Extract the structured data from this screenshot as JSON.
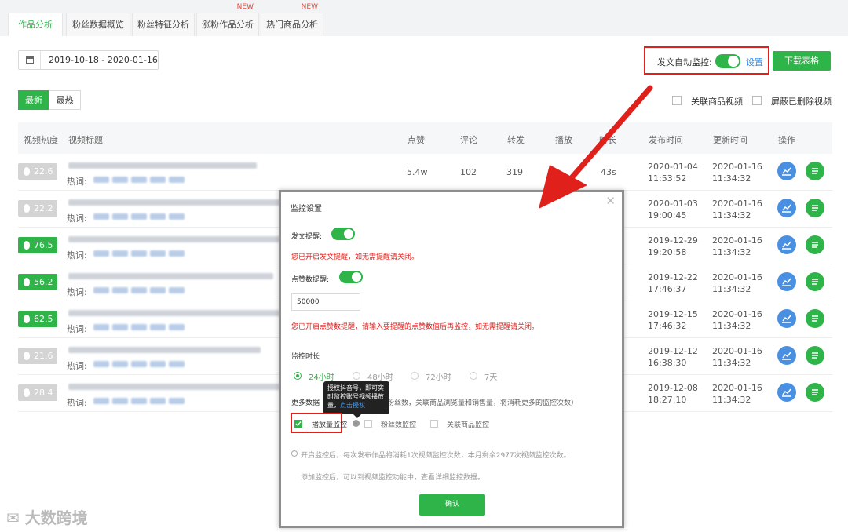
{
  "tabs": [
    {
      "label": "作品分析",
      "badge": ""
    },
    {
      "label": "粉丝数据概览",
      "badge": ""
    },
    {
      "label": "粉丝特征分析",
      "badge": ""
    },
    {
      "label": "涨粉作品分析",
      "badge": "NEW"
    },
    {
      "label": "热门商品分析",
      "badge": "NEW"
    }
  ],
  "date_range": "2019-10-18 - 2020-01-16",
  "auto_monitor": {
    "label": "发文自动监控:",
    "enabled": true,
    "settings_link": "设置"
  },
  "download_button": "下载表格",
  "sort": {
    "latest": "最新",
    "hottest": "最热"
  },
  "filters": {
    "linked_products": "关联商品视频",
    "hide_deleted": "屏蔽已删除视频"
  },
  "table": {
    "headers": [
      "视频热度",
      "视频标题",
      "点赞",
      "评论",
      "转发",
      "播放",
      "时长",
      "发布时间",
      "更新时间",
      "操作"
    ],
    "hot_label": "热词:",
    "rows": [
      {
        "heat": "22.6",
        "level": "low",
        "likes": "5.4w",
        "comments": "102",
        "shares": "319",
        "duration": "43s",
        "pub_date": "2020-01-04",
        "pub_time": "11:53:52",
        "upd_date": "2020-01-16",
        "upd_time": "11:34:32"
      },
      {
        "heat": "22.2",
        "level": "low",
        "pub_date": "2020-01-03",
        "pub_time": "19:00:45",
        "upd_date": "2020-01-16",
        "upd_time": "11:34:32"
      },
      {
        "heat": "76.5",
        "level": "high",
        "pub_date": "2019-12-29",
        "pub_time": "19:20:58",
        "upd_date": "2020-01-16",
        "upd_time": "11:34:32"
      },
      {
        "heat": "56.2",
        "level": "high",
        "pub_date": "2019-12-22",
        "pub_time": "17:46:37",
        "upd_date": "2020-01-16",
        "upd_time": "11:34:32"
      },
      {
        "heat": "62.5",
        "level": "high",
        "pub_date": "2019-12-15",
        "pub_time": "17:46:32",
        "upd_date": "2020-01-16",
        "upd_time": "11:34:32"
      },
      {
        "heat": "21.6",
        "level": "low",
        "pub_date": "2019-12-12",
        "pub_time": "16:38:30",
        "upd_date": "2020-01-16",
        "upd_time": "11:34:32"
      },
      {
        "heat": "28.4",
        "level": "low",
        "pub_date": "2019-12-08",
        "pub_time": "18:27:10",
        "upd_date": "2020-01-16",
        "upd_time": "11:34:32"
      }
    ]
  },
  "modal": {
    "title": "监控设置",
    "post_alert_label": "发文提醒:",
    "post_alert_note": "您已开启发文提醒，如无需提醒请关闭。",
    "like_alert_label": "点赞数提醒:",
    "like_threshold": "50000",
    "like_alert_note": "您已开启点赞数提醒，请输入要提醒的点赞数值后再监控，如无需提醒请关闭。",
    "duration_label": "监控时长",
    "durations": [
      "24小时",
      "48小时",
      "72小时",
      "7天"
    ],
    "more_data_prefix": "更多数据",
    "more_data_suffix": "粉丝数，关联商品浏览量和销售量，将消耗更多的监控次数）",
    "options": [
      "播放量监控",
      "粉丝数监控",
      "关联商品监控"
    ],
    "tooltip_line1": "授权抖音号，即可实",
    "tooltip_line2": "时监控账号视频播放",
    "tooltip_line3_prefix": "量，",
    "tooltip_link": "点击授权",
    "info1": "开启监控后，每次发布作品将消耗1次视频监控次数，本月剩余2977次视频监控次数。",
    "info2": "添加监控后，可以到视频监控功能中，查看详细监控数据。",
    "confirm": "确认"
  },
  "watermark": "大数跨境",
  "colors": {
    "accent": "#2fb44a",
    "annotation": "#e0211b",
    "link": "#2d8cf0"
  }
}
